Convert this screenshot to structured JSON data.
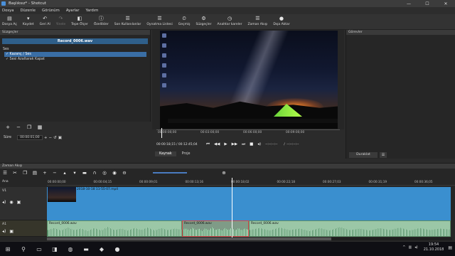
{
  "window": {
    "title": "Başlıksız* - Shotcut",
    "buttons": [
      "—",
      "☐",
      "✕"
    ]
  },
  "menu": [
    "Dosya",
    "Düzenle",
    "Görünüm",
    "Ayarlar",
    "Yardım"
  ],
  "toolbar": [
    {
      "icon": "▤",
      "label": "Dosya Aç",
      "enabled": true,
      "name": "open-file"
    },
    {
      "icon": "▾",
      "label": "Kaydet",
      "enabled": true,
      "name": "save"
    },
    {
      "icon": "↶",
      "label": "Geri Al",
      "enabled": true,
      "name": "undo"
    },
    {
      "icon": "↷",
      "label": "Yinele",
      "enabled": false,
      "name": "redo"
    },
    {
      "icon": "◧",
      "label": "Tepe Ölçer",
      "enabled": true,
      "name": "peak-meter"
    },
    {
      "icon": "ⓘ",
      "label": "Özellikler",
      "enabled": true,
      "name": "properties"
    },
    {
      "icon": "☰",
      "label": "Son Kullanılanlar",
      "enabled": true,
      "name": "recent"
    },
    {
      "icon": "☰",
      "label": "Oynatma Listesi",
      "enabled": true,
      "name": "playlist"
    },
    {
      "icon": "⏲",
      "label": "Geçmiş",
      "enabled": true,
      "name": "history"
    },
    {
      "icon": "⚙",
      "label": "Süzgeçler",
      "enabled": true,
      "name": "filters"
    },
    {
      "icon": "◷",
      "label": "Anahtar kareler",
      "enabled": true,
      "name": "keyframes"
    },
    {
      "icon": "☰",
      "label": "Zaman Akışı",
      "enabled": true,
      "name": "timeline"
    },
    {
      "icon": "●",
      "label": "Dışa Aktar",
      "enabled": true,
      "name": "export"
    }
  ],
  "filters": {
    "panel_title": "Süzgeçler",
    "clip_name": "Record_0006.wav",
    "section": "Ses",
    "items": [
      {
        "label": "Kazanç / Ses",
        "selected": true
      },
      {
        "label": "Sesi Azaltarak Kapat",
        "selected": false
      }
    ],
    "duration_label": "Süre",
    "duration": "00:00:01;00"
  },
  "viewer": {
    "ruler_ticks": [
      "00:00:00;00",
      "00:03:00;00",
      "00:06:00;00",
      "00:09:00;00"
    ],
    "position": "00:00:18;15",
    "total": "/ 00:12:45;04",
    "in": "--:--:--:--",
    "out": "--:--:--:--",
    "tabs": [
      "Kaynak",
      "Proje"
    ]
  },
  "properties": {
    "panel_title": "Görevler",
    "detach_label": "Duraklat",
    "menu_icon": "☰"
  },
  "timeline": {
    "panel_title": "Zaman Akışı",
    "header_label": "Ana",
    "ruler_ticks": [
      "00:00:00;00",
      "00:00:04;15",
      "00:00:09;01",
      "00:00:13;16",
      "00:00:18;02",
      "00:00:22;18",
      "00:00:27;03",
      "00:00:31;19",
      "00:00:36;05"
    ],
    "tracks": [
      {
        "name": "V1",
        "clips": [
          {
            "name": "2018-10-18 11-55-07.mp4"
          }
        ]
      },
      {
        "name": "A1",
        "clips": [
          {
            "name": "Record_0006.wav",
            "selected": false
          },
          {
            "name": "Record_0006.wav",
            "selected": true
          },
          {
            "name": "Record_0006.wav",
            "selected": false
          }
        ]
      }
    ]
  },
  "taskbar": {
    "time": "19:54",
    "date": "21.10.2018"
  }
}
